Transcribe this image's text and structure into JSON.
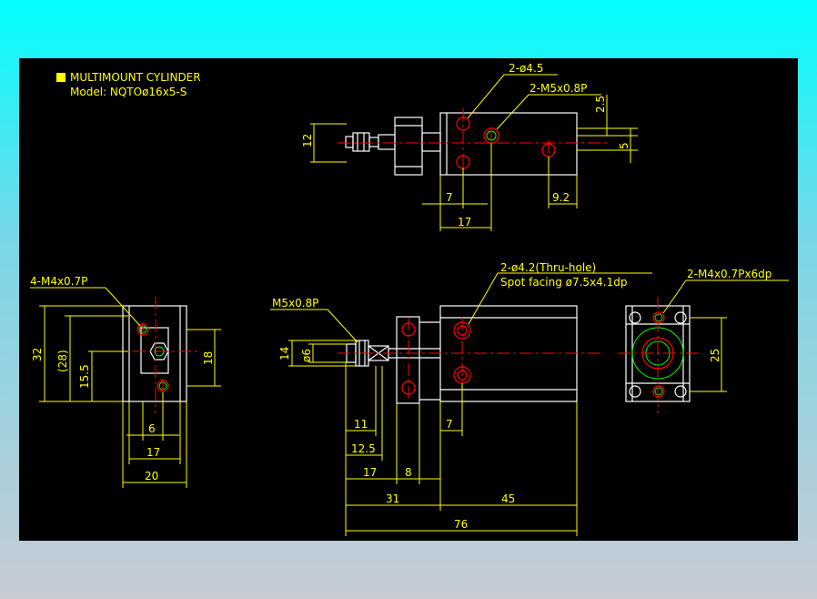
{
  "title": {
    "line1": "MULTIMOUNT CYLINDER",
    "line2": "Model: NQTOø16x5-S"
  },
  "top_view": {
    "hole_note": "2-ø4.5",
    "port_note": "2-M5x0.8P",
    "dim_12": "12",
    "dim_2_5": "2.5",
    "dim_5": "5",
    "dim_7": "7",
    "dim_9_2": "9.2",
    "dim_17": "17"
  },
  "left_view": {
    "thread_note": "4-M4x0.7P",
    "dim_32": "32",
    "dim_28": "(28)",
    "dim_15_5": "15.5",
    "dim_18": "18",
    "dim_6": "6",
    "dim_17": "17",
    "dim_20": "20"
  },
  "front_view": {
    "port_note": "M5x0.8P",
    "thru_note": "2-ø4.2(Thru-hole)",
    "spot_note": "Spot facing ø7.5x4.1dp",
    "dim_14": "14",
    "dim_d6": "ø6",
    "dim_11": "11",
    "dim_12_5": "12.5",
    "dim_17": "17",
    "dim_8": "8",
    "dim_7": "7",
    "dim_31": "31",
    "dim_45": "45",
    "dim_76": "76"
  },
  "right_view": {
    "thread_note": "2-M4x0.7Px6dp",
    "dim_25": "25"
  },
  "colors": {
    "outline": "#ffffff",
    "dimension": "#ffff00",
    "centerline": "#ff0000",
    "thread": "#00ff00",
    "background": "#000000"
  }
}
